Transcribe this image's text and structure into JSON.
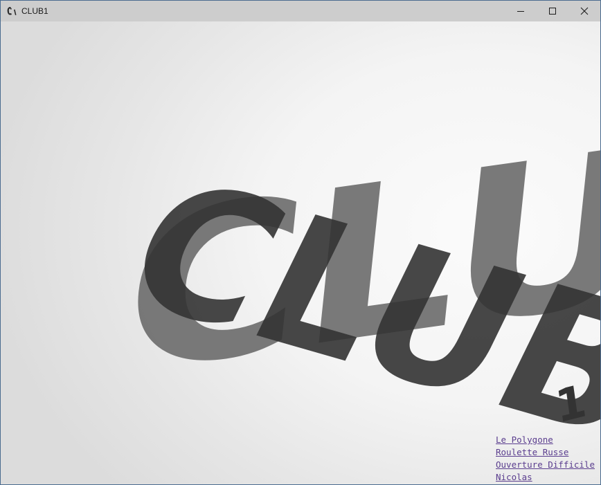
{
  "window": {
    "title": "CLUB1",
    "icon": "club1-app-icon",
    "controls": [
      "minimize-icon",
      "maximize-icon",
      "close-icon"
    ]
  },
  "logo": {
    "back_word": "CLUB",
    "front_word": "CLUB",
    "suffix": "1",
    "front_color": "#3a3a3a",
    "back_color": "#6e6e6e"
  },
  "links": [
    {
      "label": "Le Polygone"
    },
    {
      "label": "Roulette Russe"
    },
    {
      "label": "Ouverture Difficile"
    },
    {
      "label": "Nicolas"
    }
  ],
  "colors": {
    "link": "#5a3d8e",
    "titlebar": "#cdcdcd"
  }
}
